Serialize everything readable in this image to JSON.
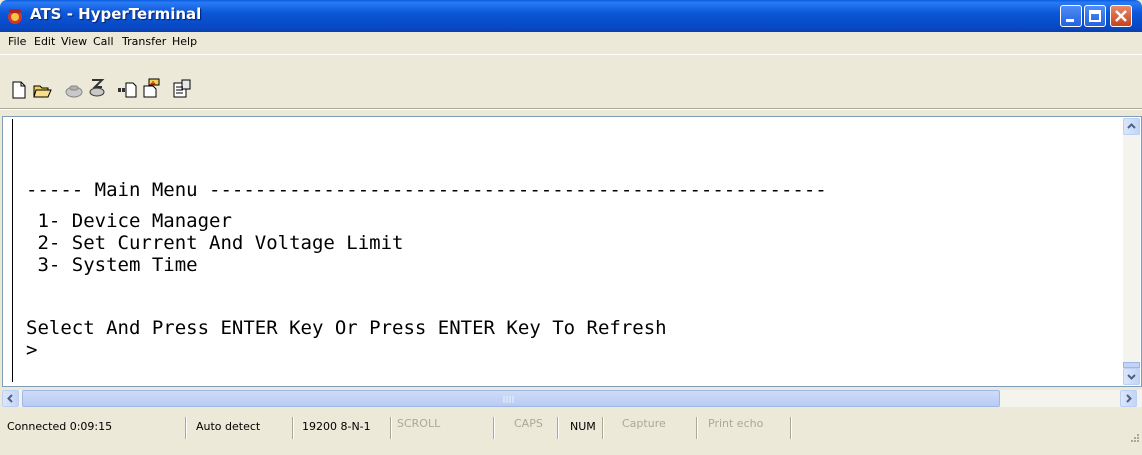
{
  "window": {
    "title": "ATS - HyperTerminal"
  },
  "menu": [
    "File",
    "Edit",
    "View",
    "Call",
    "Transfer",
    "Help"
  ],
  "toolbar": {
    "icons": [
      "new-icon",
      "open-icon",
      "call-icon",
      "disconnect-icon",
      "send-icon",
      "receive-icon",
      "properties-icon"
    ]
  },
  "terminal": {
    "lines": [
      "----- Main Menu ------------------------------------------------------",
      " 1- Device Manager",
      " 2- Set Current And Voltage Limit",
      " 3- System Time",
      "Select And Press ENTER Key Or Press ENTER Key To Refresh",
      ">"
    ]
  },
  "status": {
    "connected": "Connected 0:09:15",
    "detect": "Auto detect",
    "port": "19200 8-N-1",
    "scroll": "SCROLL",
    "caps": "CAPS",
    "num": "NUM",
    "capture": "Capture",
    "print_echo": "Print echo"
  },
  "colors": {
    "titlebar": "#0a58d8",
    "chrome": "#ece9d8",
    "terminal_bg": "#ffffff",
    "terminal_text": "#000000",
    "status_dim": "#aca899"
  }
}
